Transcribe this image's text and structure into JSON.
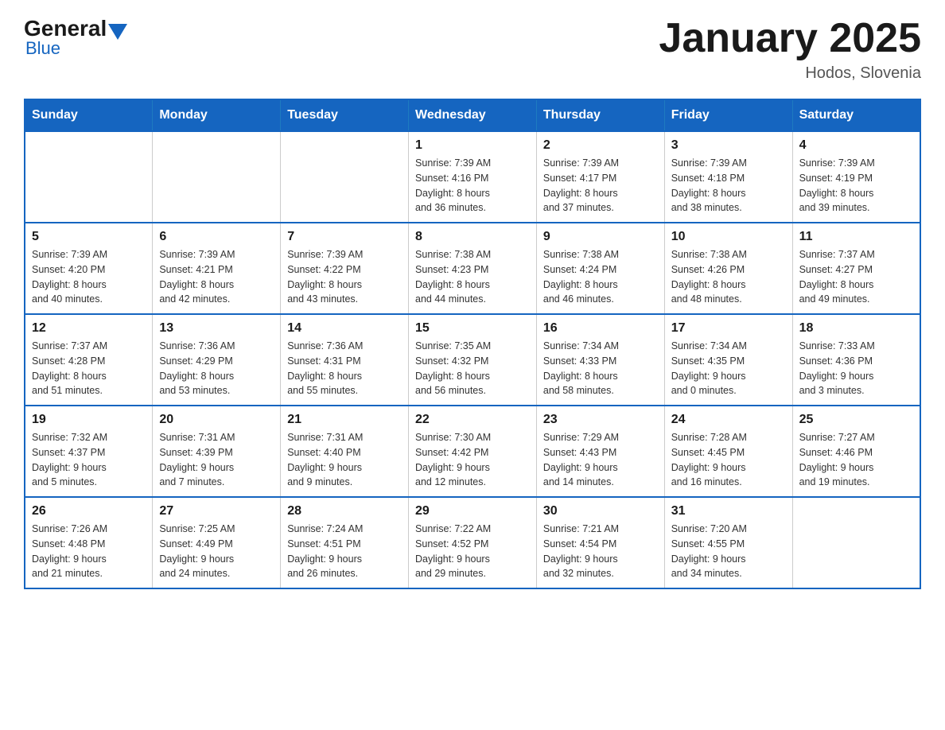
{
  "header": {
    "logo": {
      "general": "General",
      "blue": "Blue"
    },
    "title": "January 2025",
    "location": "Hodos, Slovenia"
  },
  "days_of_week": [
    "Sunday",
    "Monday",
    "Tuesday",
    "Wednesday",
    "Thursday",
    "Friday",
    "Saturday"
  ],
  "weeks": [
    [
      {
        "day": "",
        "info": ""
      },
      {
        "day": "",
        "info": ""
      },
      {
        "day": "",
        "info": ""
      },
      {
        "day": "1",
        "info": "Sunrise: 7:39 AM\nSunset: 4:16 PM\nDaylight: 8 hours\nand 36 minutes."
      },
      {
        "day": "2",
        "info": "Sunrise: 7:39 AM\nSunset: 4:17 PM\nDaylight: 8 hours\nand 37 minutes."
      },
      {
        "day": "3",
        "info": "Sunrise: 7:39 AM\nSunset: 4:18 PM\nDaylight: 8 hours\nand 38 minutes."
      },
      {
        "day": "4",
        "info": "Sunrise: 7:39 AM\nSunset: 4:19 PM\nDaylight: 8 hours\nand 39 minutes."
      }
    ],
    [
      {
        "day": "5",
        "info": "Sunrise: 7:39 AM\nSunset: 4:20 PM\nDaylight: 8 hours\nand 40 minutes."
      },
      {
        "day": "6",
        "info": "Sunrise: 7:39 AM\nSunset: 4:21 PM\nDaylight: 8 hours\nand 42 minutes."
      },
      {
        "day": "7",
        "info": "Sunrise: 7:39 AM\nSunset: 4:22 PM\nDaylight: 8 hours\nand 43 minutes."
      },
      {
        "day": "8",
        "info": "Sunrise: 7:38 AM\nSunset: 4:23 PM\nDaylight: 8 hours\nand 44 minutes."
      },
      {
        "day": "9",
        "info": "Sunrise: 7:38 AM\nSunset: 4:24 PM\nDaylight: 8 hours\nand 46 minutes."
      },
      {
        "day": "10",
        "info": "Sunrise: 7:38 AM\nSunset: 4:26 PM\nDaylight: 8 hours\nand 48 minutes."
      },
      {
        "day": "11",
        "info": "Sunrise: 7:37 AM\nSunset: 4:27 PM\nDaylight: 8 hours\nand 49 minutes."
      }
    ],
    [
      {
        "day": "12",
        "info": "Sunrise: 7:37 AM\nSunset: 4:28 PM\nDaylight: 8 hours\nand 51 minutes."
      },
      {
        "day": "13",
        "info": "Sunrise: 7:36 AM\nSunset: 4:29 PM\nDaylight: 8 hours\nand 53 minutes."
      },
      {
        "day": "14",
        "info": "Sunrise: 7:36 AM\nSunset: 4:31 PM\nDaylight: 8 hours\nand 55 minutes."
      },
      {
        "day": "15",
        "info": "Sunrise: 7:35 AM\nSunset: 4:32 PM\nDaylight: 8 hours\nand 56 minutes."
      },
      {
        "day": "16",
        "info": "Sunrise: 7:34 AM\nSunset: 4:33 PM\nDaylight: 8 hours\nand 58 minutes."
      },
      {
        "day": "17",
        "info": "Sunrise: 7:34 AM\nSunset: 4:35 PM\nDaylight: 9 hours\nand 0 minutes."
      },
      {
        "day": "18",
        "info": "Sunrise: 7:33 AM\nSunset: 4:36 PM\nDaylight: 9 hours\nand 3 minutes."
      }
    ],
    [
      {
        "day": "19",
        "info": "Sunrise: 7:32 AM\nSunset: 4:37 PM\nDaylight: 9 hours\nand 5 minutes."
      },
      {
        "day": "20",
        "info": "Sunrise: 7:31 AM\nSunset: 4:39 PM\nDaylight: 9 hours\nand 7 minutes."
      },
      {
        "day": "21",
        "info": "Sunrise: 7:31 AM\nSunset: 4:40 PM\nDaylight: 9 hours\nand 9 minutes."
      },
      {
        "day": "22",
        "info": "Sunrise: 7:30 AM\nSunset: 4:42 PM\nDaylight: 9 hours\nand 12 minutes."
      },
      {
        "day": "23",
        "info": "Sunrise: 7:29 AM\nSunset: 4:43 PM\nDaylight: 9 hours\nand 14 minutes."
      },
      {
        "day": "24",
        "info": "Sunrise: 7:28 AM\nSunset: 4:45 PM\nDaylight: 9 hours\nand 16 minutes."
      },
      {
        "day": "25",
        "info": "Sunrise: 7:27 AM\nSunset: 4:46 PM\nDaylight: 9 hours\nand 19 minutes."
      }
    ],
    [
      {
        "day": "26",
        "info": "Sunrise: 7:26 AM\nSunset: 4:48 PM\nDaylight: 9 hours\nand 21 minutes."
      },
      {
        "day": "27",
        "info": "Sunrise: 7:25 AM\nSunset: 4:49 PM\nDaylight: 9 hours\nand 24 minutes."
      },
      {
        "day": "28",
        "info": "Sunrise: 7:24 AM\nSunset: 4:51 PM\nDaylight: 9 hours\nand 26 minutes."
      },
      {
        "day": "29",
        "info": "Sunrise: 7:22 AM\nSunset: 4:52 PM\nDaylight: 9 hours\nand 29 minutes."
      },
      {
        "day": "30",
        "info": "Sunrise: 7:21 AM\nSunset: 4:54 PM\nDaylight: 9 hours\nand 32 minutes."
      },
      {
        "day": "31",
        "info": "Sunrise: 7:20 AM\nSunset: 4:55 PM\nDaylight: 9 hours\nand 34 minutes."
      },
      {
        "day": "",
        "info": ""
      }
    ]
  ]
}
